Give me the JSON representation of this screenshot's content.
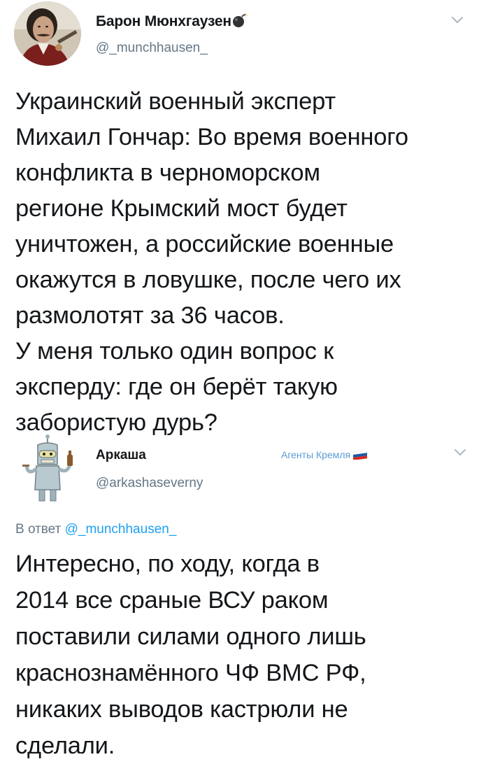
{
  "tweet1": {
    "author_name": "Барон Мюнхгаузен",
    "handle": "@_munchhausen_",
    "avatar_icon": "portrait-avatar",
    "name_badge_icon": "bomb-icon",
    "menu_icon": "chevron-down-icon",
    "text_lines": [
      "Украинский военный эксперт",
      "Михаил Гончар: Во время военного",
      "конфликта в черноморском",
      "регионе Крымский мост будет",
      "уничтожен, а российские военные",
      "окажутся в ловушке, после чего их",
      "размолотят за 36 часов.",
      "У меня только один вопрос к",
      "эксперду: где он берёт такую",
      "забористую дурь?"
    ]
  },
  "tweet2": {
    "author_name": "Аркаша",
    "handle": "@arkashaseverny",
    "avatar_icon": "robot-avatar",
    "badge_text": "Агенты Кремля",
    "badge_icon": "russian-flag-icon",
    "menu_icon": "chevron-down-icon",
    "reply_prefix": "В ответ",
    "reply_mention": "@_munchhausen_",
    "text_lines": [
      "Интересно, по ходу, когда в",
      "2014 все сраные ВСУ раком",
      "поставили силами одного лишь",
      "краснознамённого ЧФ ВМС РФ,",
      "никаких выводов кастрюли не",
      "сделали."
    ]
  },
  "colors": {
    "text": "#14171a",
    "secondary": "#657786",
    "link": "#1da1f2",
    "badge": "#5b9bd5",
    "chevron": "#aab8c2"
  }
}
